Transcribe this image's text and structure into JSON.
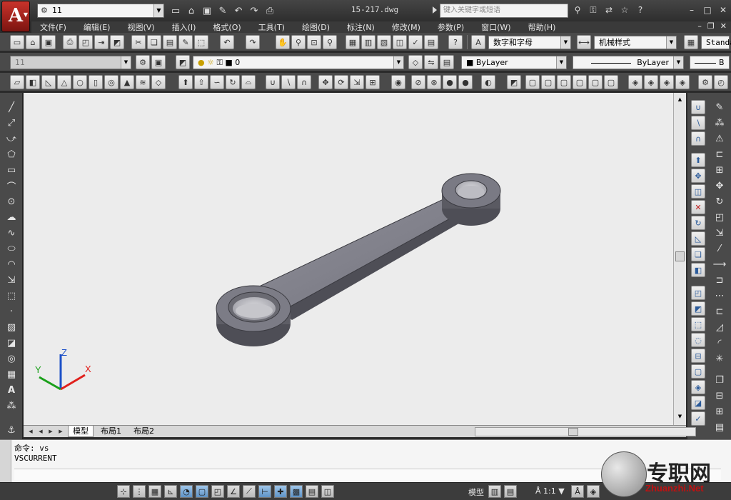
{
  "titlebar": {
    "workspace": "11",
    "doc_title": "15-217.dwg",
    "search_placeholder": "键入关键字或短语"
  },
  "menu": [
    "文件(F)",
    "编辑(E)",
    "视图(V)",
    "插入(I)",
    "格式(O)",
    "工具(T)",
    "绘图(D)",
    "标注(N)",
    "修改(M)",
    "参数(P)",
    "窗口(W)",
    "帮助(H)"
  ],
  "toolbar1": {
    "text_style": "数字和字母",
    "dim_style": "机械样式",
    "table_style": "Standa"
  },
  "toolbar2": {
    "workspace_combo": "11",
    "layer": "0",
    "color": "ByLayer",
    "linetype": "ByLayer",
    "lineweight": "B"
  },
  "layout_tabs": [
    "模型",
    "布局1",
    "布局2"
  ],
  "command_history": [
    "命令: vs",
    "VSCURRENT"
  ],
  "status": {
    "model_label": "模型",
    "scale": "1:1"
  },
  "ucs": {
    "x": "X",
    "y": "Y",
    "z": "Z"
  },
  "watermark": {
    "cn": "专职网",
    "en": "Zhuanzhi.Net"
  },
  "colors": {
    "viewport_bg": "#ececec",
    "part_face": "#6d6d78",
    "part_top": "#8a8a94",
    "part_dark": "#4e4e56",
    "ucs_x": "#e0201c",
    "ucs_y": "#1aa01a",
    "ucs_z": "#1c50c8"
  }
}
